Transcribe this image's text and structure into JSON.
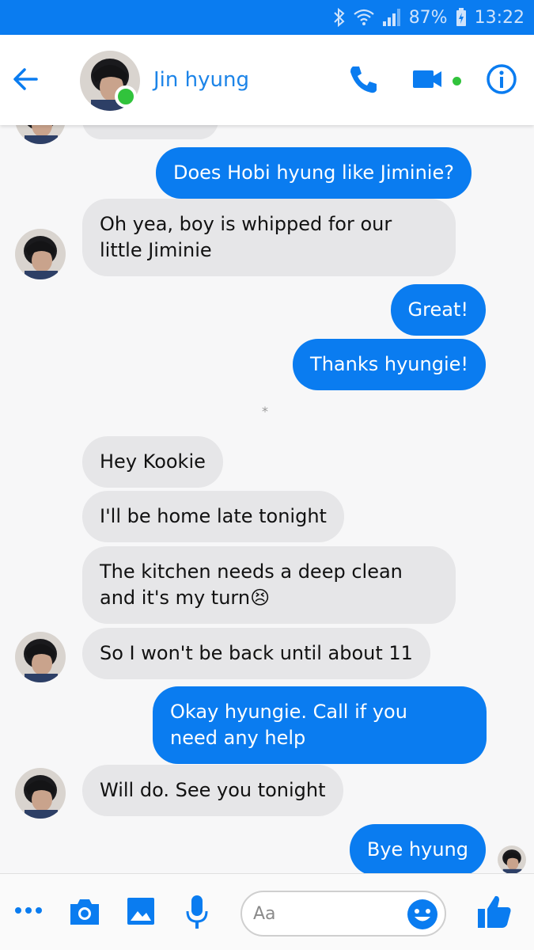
{
  "status_bar": {
    "battery": "87%",
    "time": "13:22",
    "icons": [
      "bluetooth-icon",
      "wifi-icon",
      "signal-icon",
      "battery-charging-icon"
    ]
  },
  "header": {
    "contact_name": "Jin hyung",
    "icons": [
      "back-arrow-icon",
      "phone-icon",
      "video-icon",
      "info-icon"
    ],
    "online": true
  },
  "messages": [
    {
      "from": "me",
      "text": "Does Hobi hyung like Jiminie?"
    },
    {
      "from": "them",
      "text": "Oh yea, boy is whipped for our\nlittle Jiminie"
    },
    {
      "from": "me",
      "text": "Great!"
    },
    {
      "from": "me",
      "text": "Thanks hyungie!"
    },
    {
      "from": "divider",
      "text": "*"
    },
    {
      "from": "them",
      "text": "Hey Kookie"
    },
    {
      "from": "them",
      "text": "I'll be home late tonight"
    },
    {
      "from": "them",
      "text": "The kitchen needs a deep clean\nand it's my turn😣"
    },
    {
      "from": "them",
      "text": "So I won't be back until about 11"
    },
    {
      "from": "me",
      "text": "Okay hyungie. Call if you\nneed any help"
    },
    {
      "from": "them",
      "text": "Will do. See you tonight"
    },
    {
      "from": "me",
      "text": "Bye hyung"
    }
  ],
  "composer": {
    "placeholder": "Aa",
    "icons": [
      "more-icon",
      "camera-icon",
      "gallery-icon",
      "microphone-icon",
      "emoji-icon",
      "thumbs-up-icon"
    ]
  },
  "colors": {
    "accent": "#0a7cf0",
    "incoming_bubble": "#e6e6e8",
    "online": "#31c33c"
  }
}
